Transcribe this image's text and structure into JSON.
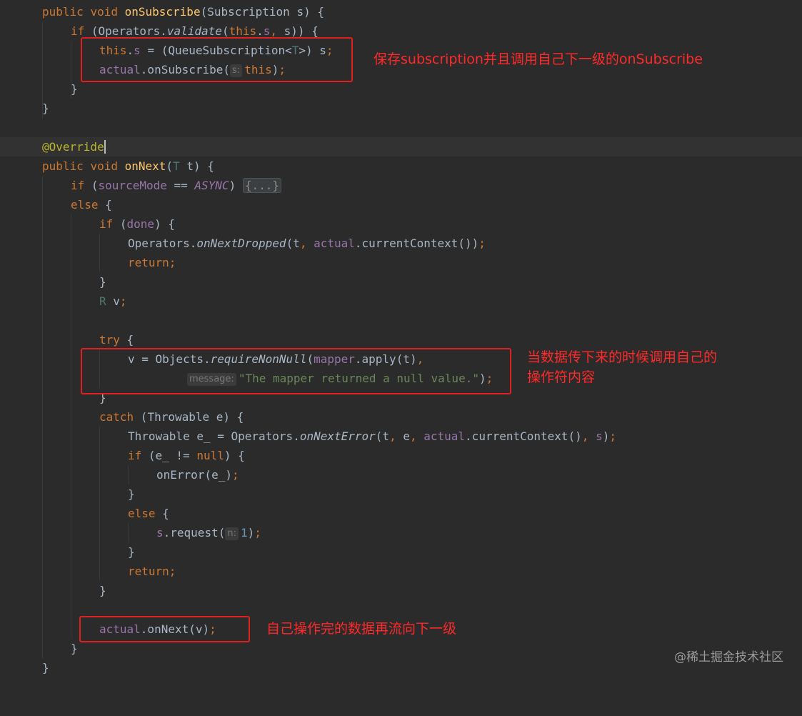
{
  "code": {
    "l1_sig_public": "public",
    "l1_sig_void": "void",
    "l1_sig_name": "onSubscribe",
    "l1_sig_params": "(Subscription s) {",
    "l2_if": "if",
    "l2_ops": "(Operators.",
    "l2_validate": "validate",
    "l2_paren": "(",
    "l2_this": "this",
    "l2_dot": ".",
    "l2_s": "s",
    "l2_comma": ",",
    "l2_rest": " s)) {",
    "l3_this": "this",
    "l3_dot": ".",
    "l3_s": "s",
    "l3_eq": " = (QueueSubscription<",
    "l3_T": "T",
    "l3_rest": ">) s",
    "l3_semi": ";",
    "l4_actual": "actual",
    "l4_call": ".onSubscribe(",
    "l4_hint": "s:",
    "l4_this": "this",
    "l4_rest": ")",
    "l4_semi": ";",
    "brace_close": "}",
    "override": "@Override",
    "l9_public": "public",
    "l9_void": "void",
    "l9_name": "onNext",
    "l9_open": "(",
    "l9_T": "T",
    "l9_rest": " t) {",
    "l10_if": "if",
    "l10_open": " (",
    "l10_mode": "sourceMode",
    "l10_eq": " == ",
    "l10_async": "ASYNC",
    "l10_close": ") ",
    "l10_fold": "{...}",
    "l11_else": "else",
    "l11_rest": " {",
    "l12_if": "if",
    "l12_open": " (",
    "l12_done": "done",
    "l12_rest": ") {",
    "l13_ops": "Operators.",
    "l13_fn": "onNextDropped",
    "l13_open": "(t",
    "l13_comma": ",",
    "l13_actual": "actual",
    "l13_rest": ".currentContext())",
    "l13_semi": ";",
    "return_kw": "return",
    "semi": ";",
    "l16_R": "R",
    "l16_v": " v",
    "l18_try": "try",
    "l18_rest": " {",
    "l19_v": "v = Objects.",
    "l19_fn": "requireNonNull",
    "l19_open": "(",
    "l19_mapper": "mapper",
    "l19_rest": ".apply(t)",
    "l19_comma": ",",
    "l20_hint": "message:",
    "l20_str": "\"The mapper returned a null value.\"",
    "l20_rest": ")",
    "l22_catch": "catch",
    "l22_rest": " (Throwable e) {",
    "l23_a": "Throwable e_ = Operators.",
    "l23_fn": "onNextError",
    "l23_b": "(t",
    "l23_c1": ",",
    "l23_e": " e",
    "l23_c2": ",",
    "l23_actual": "actual",
    "l23_cc": ".currentContext()",
    "l23_c3": ",",
    "l23_s": "s",
    "l23_end": ")",
    "l24_if": "if",
    "l24_a": " (e_ != ",
    "l24_null": "null",
    "l24_b": ") {",
    "l25_call": "onError(e_)",
    "l27_else": "else",
    "l27_rest": " {",
    "l28_s": "s",
    "l28_call": ".request(",
    "l28_hint": "n:",
    "l28_num": "1",
    "l28_end": ")",
    "l32_actual": "actual",
    "l32_call": ".onNext(v)"
  },
  "annotations": {
    "note1": "保存subscription并且调用自己下一级的onSubscribe",
    "note2_line1": "当数据传下来的时候调用自己的",
    "note2_line2": "操作符内容",
    "note3": "自己操作完的数据再流向下一级"
  },
  "watermark": "@稀土掘金技术社区",
  "colors": {
    "background": "#2b2b2b",
    "keyword": "#cc7832",
    "function": "#ffc66d",
    "field": "#9876aa",
    "string": "#6a8759",
    "annotation_box": "#e02020",
    "annotation_text": "#ff2a2a"
  }
}
